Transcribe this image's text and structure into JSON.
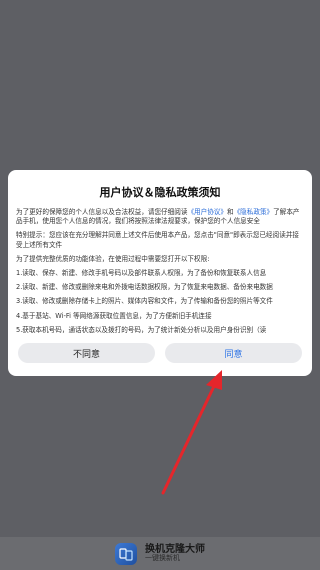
{
  "dialog": {
    "title": "用户协议＆隐私政策须知",
    "para1_a": "为了更好的保障您的个人信息以及合法权益，请您仔细阅读",
    "link_user_agreement": "《用户协议》",
    "para1_b": "和",
    "link_privacy": "《隐私政策》",
    "para1_c": "了解本产品手机，使用您个人信息的情况，我们将按照法律法规要求，保护您的个人信息安全",
    "para2": "特别提示：您应该在充分理解并同意上述文件后使用本产品，您点击\"同意\"即表示您已经阅读并接受上述所有文件",
    "para3": "为了提供完整优质的功能体验，在使用过程中需要您打开以下权限:",
    "item1": "1.读取、保存、新建、修改手机号码以及部件联系人权限，为了备份和恢复联系人信息",
    "item2": "2.读取、新建、修改或删除来电和外拨电话数据权限，为了恢复来电数据、备份来电数据",
    "item3": "3.读取、修改或删除存储卡上的照片、媒体内容和文件，为了传输和备份您的照片等文件",
    "item4": "4.基于基站、Wi-Fi 等网络源获取位置信息，为了方便新旧手机连接",
    "item5": "5.获取本机号码，通话状态以及拨打的号码，为了统计新处分析以及用户身份识别（读",
    "disagree_label": "不同意",
    "agree_label": "同意"
  },
  "app": {
    "name": "换机克隆大师",
    "slogan": "一键换新机"
  },
  "colors": {
    "overlay": "#5e5f64",
    "link": "#2a6cd8",
    "agree_text": "#2d74e6",
    "arrow": "#e5262b"
  }
}
